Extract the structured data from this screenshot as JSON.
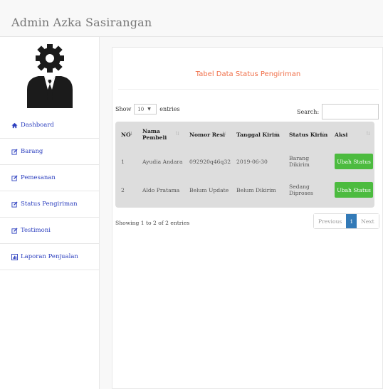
{
  "brand": "Admin Azka Sasirangan",
  "sidebar": {
    "items": [
      {
        "label": "Dashboard",
        "icon": "home-icon"
      },
      {
        "label": "Barang",
        "icon": "edit-icon"
      },
      {
        "label": "Pemesanan",
        "icon": "edit-icon"
      },
      {
        "label": "Status Pengiriman",
        "icon": "edit-icon"
      },
      {
        "label": "Testimoni",
        "icon": "edit-icon"
      },
      {
        "label": "Laporan Penjualan",
        "icon": "chart-icon"
      }
    ]
  },
  "panel": {
    "title": "Tabel Data Status Pengiriman",
    "show_label": "Show",
    "entries_value": "10",
    "entries_label": "entries",
    "search_label": "Search:",
    "search_value": ""
  },
  "table": {
    "headers": [
      "NO",
      "Nama Pembeli",
      "Nomor Resi",
      "Tanggal Kirim",
      "Status Kirim",
      "Aksi"
    ],
    "rows": [
      [
        "1",
        "Ayudia Andara",
        "092920q46q32",
        "2019-06-30",
        "Barang Dikirim",
        "Ubah Status"
      ],
      [
        "2",
        "Aldo Pratama",
        "Belum Update",
        "Belum Dikirim",
        "Sedang Diproses",
        "Ubah Status"
      ]
    ]
  },
  "footer": {
    "info": "Showing 1 to 2 of 2 entries",
    "previous": "Previous",
    "page": "1",
    "next": "Next"
  },
  "colors": {
    "accent_title": "#f0704a",
    "nav_link": "#2c3fbf",
    "button_green": "#4cbb3f",
    "pager_active": "#337ab7"
  }
}
